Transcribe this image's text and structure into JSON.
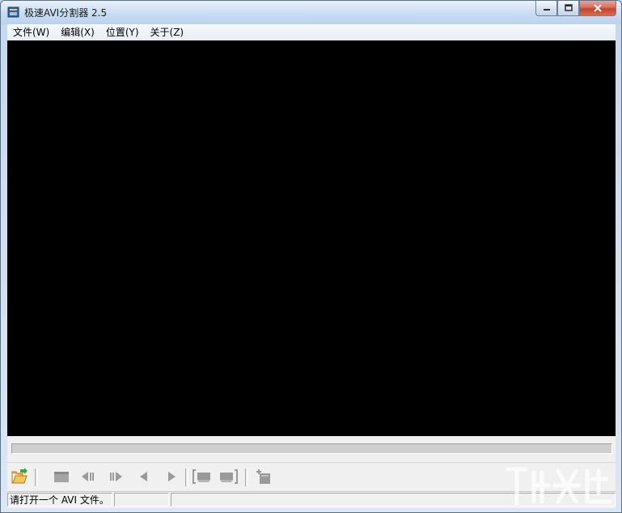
{
  "window": {
    "title": "极速AVI分割器 2.5",
    "caption_buttons": {
      "minimize": "▭",
      "maximize": "□",
      "close": "✕"
    }
  },
  "menu": [
    {
      "label": "文件(W)"
    },
    {
      "label": "编辑(X)"
    },
    {
      "label": "位置(Y)"
    },
    {
      "label": "关于(Z)"
    }
  ],
  "player": {
    "progress": 0
  },
  "toolbar": {
    "buttons": [
      {
        "icon": "open-folder-icon",
        "enabled": true
      },
      {
        "icon": "stop-icon",
        "enabled": false
      },
      {
        "icon": "step-back-icon",
        "enabled": false
      },
      {
        "icon": "step-forward-icon",
        "enabled": false
      },
      {
        "icon": "previous-icon",
        "enabled": false
      },
      {
        "icon": "play-icon",
        "enabled": false
      },
      {
        "icon": "mark-in-icon",
        "enabled": false
      },
      {
        "icon": "mark-out-icon",
        "enabled": false
      },
      {
        "icon": "add-segment-icon",
        "enabled": false
      }
    ]
  },
  "status": {
    "message": "请打开一个 AVI 文件。"
  },
  "colors": {
    "video_bg": "#000000",
    "disabled_icon": "#9a9a9a",
    "folder": "#e8b33a",
    "arrow": "#3aa83a"
  }
}
